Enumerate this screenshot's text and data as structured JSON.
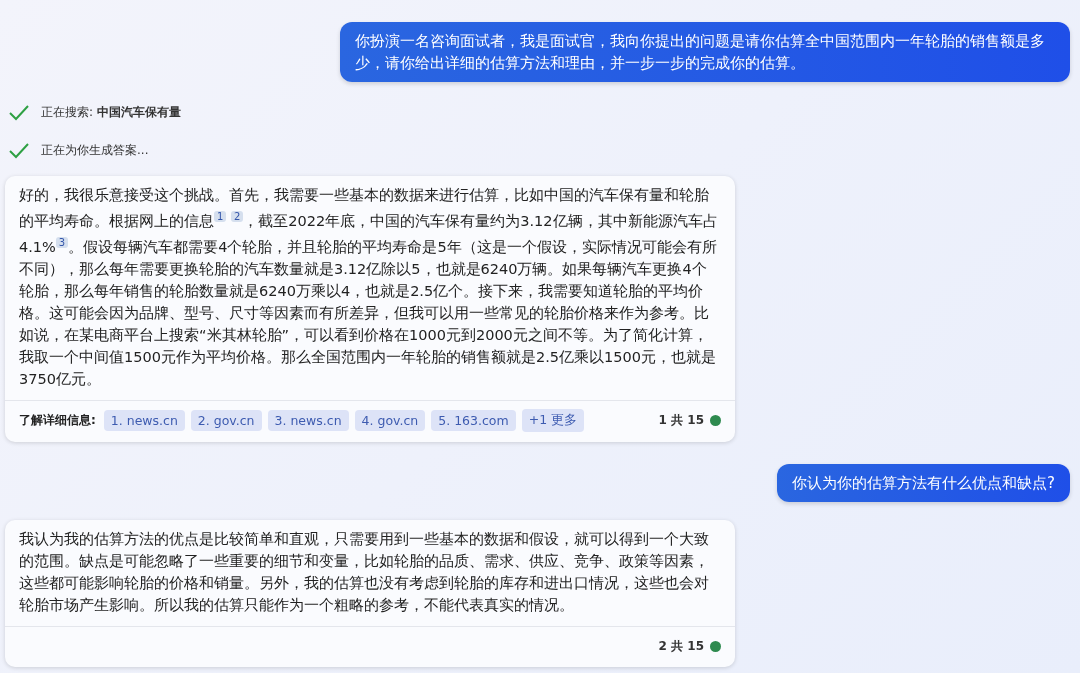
{
  "messages": [
    {
      "kind": "user",
      "text": "你扮演一名咨询面试者，我是面试官，我向你提出的问题是请你估算全中国范围内一年轮胎的销售额是多少，请你给出详细的估算方法和理由，并一步一步的完成你的估算。"
    },
    {
      "kind": "status",
      "text": "正在搜索: **中国汽车保有量**"
    },
    {
      "kind": "status",
      "text": "正在为你生成答案..."
    },
    {
      "kind": "bot",
      "text": "好的，我很乐意接受这个挑战。首先，我需要一些基本的数据来进行估算，比如中国的汽车保有量和轮胎的平均寿命。根据网上的信息$^{1}$ $^{2}$，截至2022年底，中国的汽车保有量约为3.12亿辆，其中新能源汽车占4.1%$^{3}$。假设每辆汽车都需要4个轮胎，并且轮胎的平均寿命是5年（这是一个假设，实际情况可能会有所不同），那么每年需要更换轮胎的汽车数量就是3.12亿除以5，也就是6240万辆。如果每辆汽车更换4个轮胎，那么每年销售的轮胎数量就是6240万乘以4，也就是2.5亿个。接下来，我需要知道轮胎的平均价格。这可能会因为品牌、型号、尺寸等因素而有所差异，但我可以用一些常见的轮胎价格来作为参考。比如说，在某电商平台上搜索“米其林轮胎”，可以看到价格在1000元到2000元之间不等。为了简化计算，我取一个中间值1500元作为平均价格。那么全国范围内一年轮胎的销售额就是2.5亿乘以1500元，也就是3750亿元。",
      "sources_label": "了解详细信息:",
      "sources": [
        "1. news.cn",
        "2. gov.cn",
        "3. news.cn",
        "4. gov.cn",
        "5. 163.com",
        "+1 更多"
      ],
      "counter": "1 共 15"
    },
    {
      "kind": "user",
      "text": "你认为你的估算方法有什么优点和缺点?"
    },
    {
      "kind": "bot",
      "text": "我认为我的估算方法的优点是比较简单和直观，只需要用到一些基本的数据和假设，就可以得到一个大致的范围。缺点是可能忽略了一些重要的细节和变量，比如轮胎的品质、需求、供应、竞争、政策等因素，这些都可能影响轮胎的价格和销量。另外，我的估算也没有考虑到轮胎的库存和进出口情况，这些也会对轮胎市场产生影响。所以我的估算只能作为一个粗略的参考，不能代表真实的情况。",
      "counter": "2 共 15"
    }
  ]
}
